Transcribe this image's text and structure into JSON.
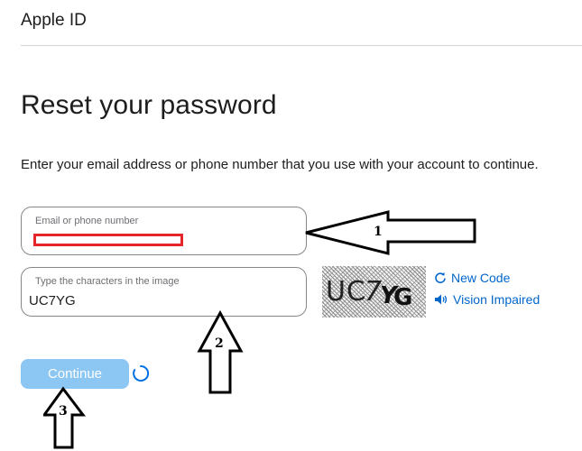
{
  "header": {
    "title": "Apple ID"
  },
  "page": {
    "title": "Reset your password",
    "instructions": "Enter your email address or phone number that you use with your account to continue."
  },
  "form": {
    "email_field": {
      "label": "Email or phone number",
      "value": ""
    },
    "captcha_field": {
      "label": "Type the characters in the image",
      "value": "UC7YG"
    },
    "captcha_image": {
      "characters": "UC7YG",
      "icon": "captcha-image"
    },
    "new_code": {
      "label": "New Code",
      "icon": "refresh-icon"
    },
    "vision_impaired": {
      "label": "Vision Impaired",
      "icon": "speaker-icon"
    },
    "continue_label": "Continue"
  },
  "annotations": {
    "arrow_1": "1",
    "arrow_2": "2",
    "arrow_3": "3"
  },
  "colors": {
    "link": "#0066cc",
    "continue_button": "#8cc6f2",
    "redaction": "#e4262b",
    "field_border": "#86868b"
  }
}
